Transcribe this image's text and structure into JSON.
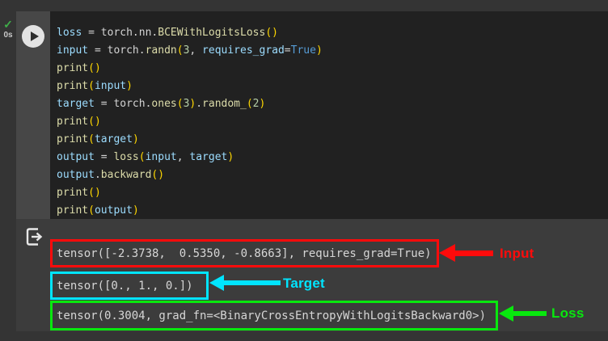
{
  "status": {
    "check_glyph": "✓",
    "exec_time": "0s"
  },
  "colors": {
    "page_bg": "#343434",
    "code_bg": "#212121",
    "strip_bg": "#474747",
    "output_bg": "#3c3c3c",
    "output_text": "#d6d6d6",
    "check_green": "#3fae49",
    "annotation_red": "#fe0b0b",
    "annotation_cyan": "#00e5ff",
    "annotation_green": "#08e80e"
  },
  "code": {
    "token_styles": {
      "v": "#9CDCFE",
      "p": "#D4D4D4",
      "f": "#DCDCAA",
      "b": "#FFD700",
      "n": "#B5CEA8",
      "k": "#569CD6"
    },
    "lines": [
      [
        [
          "v",
          "loss"
        ],
        [
          "p",
          " = "
        ],
        [
          "p",
          "torch.nn."
        ],
        [
          "f",
          "BCEWithLogitsLoss"
        ],
        [
          "b",
          "()"
        ]
      ],
      [
        [
          "v",
          "input"
        ],
        [
          "p",
          " = "
        ],
        [
          "p",
          "torch."
        ],
        [
          "f",
          "randn"
        ],
        [
          "b",
          "("
        ],
        [
          "n",
          "3"
        ],
        [
          "p",
          ", "
        ],
        [
          "v",
          "requires_grad"
        ],
        [
          "p",
          "="
        ],
        [
          "k",
          "True"
        ],
        [
          "b",
          ")"
        ]
      ],
      [
        [
          "f",
          "print"
        ],
        [
          "b",
          "()"
        ]
      ],
      [
        [
          "f",
          "print"
        ],
        [
          "b",
          "("
        ],
        [
          "v",
          "input"
        ],
        [
          "b",
          ")"
        ]
      ],
      [
        [
          "v",
          "target"
        ],
        [
          "p",
          " = "
        ],
        [
          "p",
          "torch."
        ],
        [
          "f",
          "ones"
        ],
        [
          "b",
          "("
        ],
        [
          "n",
          "3"
        ],
        [
          "b",
          ")"
        ],
        [
          "p",
          "."
        ],
        [
          "f",
          "random_"
        ],
        [
          "b",
          "("
        ],
        [
          "n",
          "2"
        ],
        [
          "b",
          ")"
        ]
      ],
      [
        [
          "f",
          "print"
        ],
        [
          "b",
          "()"
        ]
      ],
      [
        [
          "f",
          "print"
        ],
        [
          "b",
          "("
        ],
        [
          "v",
          "target"
        ],
        [
          "b",
          ")"
        ]
      ],
      [
        [
          "v",
          "output"
        ],
        [
          "p",
          " = "
        ],
        [
          "f",
          "loss"
        ],
        [
          "b",
          "("
        ],
        [
          "v",
          "input"
        ],
        [
          "p",
          ", "
        ],
        [
          "v",
          "target"
        ],
        [
          "b",
          ")"
        ]
      ],
      [
        [
          "v",
          "output"
        ],
        [
          "p",
          "."
        ],
        [
          "f",
          "backward"
        ],
        [
          "b",
          "()"
        ]
      ],
      [
        [
          "f",
          "print"
        ],
        [
          "b",
          "()"
        ]
      ],
      [
        [
          "f",
          "print"
        ],
        [
          "b",
          "("
        ],
        [
          "v",
          "output"
        ],
        [
          "b",
          ")"
        ]
      ]
    ]
  },
  "output": {
    "icon_name": "cell-output-icon",
    "rows": [
      {
        "text": "tensor([-2.3738,  0.5350, -0.8663], requires_grad=True)",
        "label": "Input",
        "color": "#fe0b0b"
      },
      {
        "text": "tensor([0., 1., 0.])",
        "label": "Target",
        "color": "#00e5ff"
      },
      {
        "text": "tensor(0.3004, grad_fn=<BinaryCrossEntropyWithLogitsBackward0>)",
        "label": "Loss",
        "color": "#08e80e"
      }
    ]
  }
}
